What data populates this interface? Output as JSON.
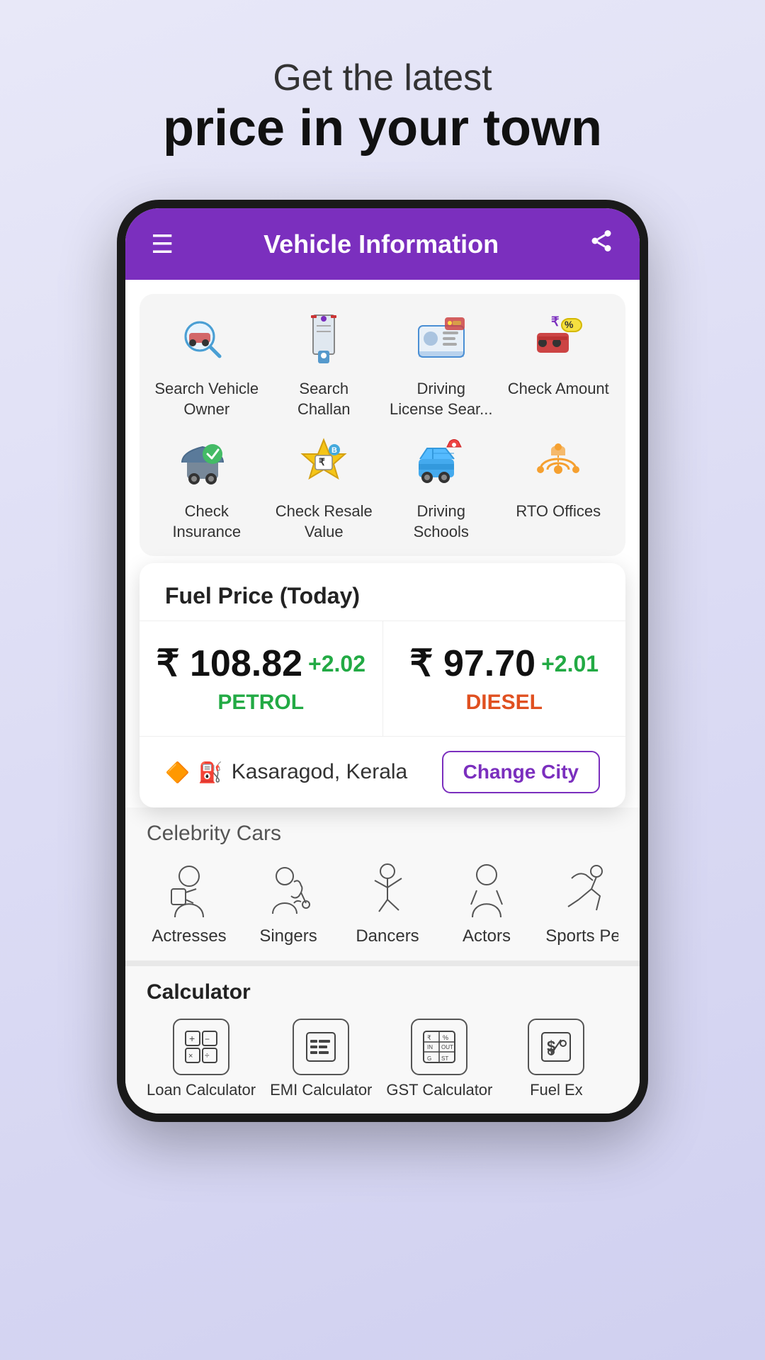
{
  "hero": {
    "subtitle": "Get the latest",
    "title": "price in your town"
  },
  "app": {
    "header_title": "Vehicle Information",
    "menu_icon": "☰",
    "share_icon": "⬆"
  },
  "vehicle_grid": {
    "items": [
      {
        "label": "Search Vehicle Owner",
        "icon": "🔍🚗"
      },
      {
        "label": "Search Challan",
        "icon": "👮"
      },
      {
        "label": "Driving License Sear...",
        "icon": "🪪🚗"
      },
      {
        "label": "Check Amount",
        "icon": "💰🚗"
      },
      {
        "label": "Check Insurance",
        "icon": "🚗✅"
      },
      {
        "label": "Check Resale Value",
        "icon": "🏷️"
      },
      {
        "label": "Driving Schools",
        "icon": "🚗🏫"
      },
      {
        "label": "RTO Offices",
        "icon": "🗺️"
      }
    ]
  },
  "fuel_card": {
    "title": "Fuel Price (Today)",
    "petrol_price": "₹ 108.82",
    "petrol_change": "+2.02",
    "petrol_label": "PETROL",
    "diesel_price": "₹ 97.70",
    "diesel_change": "+2.01",
    "diesel_label": "DIESEL",
    "location": "Kasaragod, Kerala",
    "change_city_btn": "Change City"
  },
  "celebrity_section": {
    "title": "Celebrity Cars",
    "items": [
      {
        "label": "Actresses",
        "icon": "👩‍🎤"
      },
      {
        "label": "Singers",
        "icon": "🎸"
      },
      {
        "label": "Dancers",
        "icon": "💃"
      },
      {
        "label": "Actors",
        "icon": "🎭"
      },
      {
        "label": "Sports Per",
        "icon": "🏂"
      }
    ]
  },
  "calculator_section": {
    "title": "Calculator",
    "items": [
      {
        "label": "Loan Calculator",
        "icon": "🧮"
      },
      {
        "label": "EMI Calculator",
        "icon": "📊"
      },
      {
        "label": "GST Calculator",
        "icon": "💱"
      },
      {
        "label": "Fuel Ex",
        "icon": "💲"
      }
    ]
  }
}
